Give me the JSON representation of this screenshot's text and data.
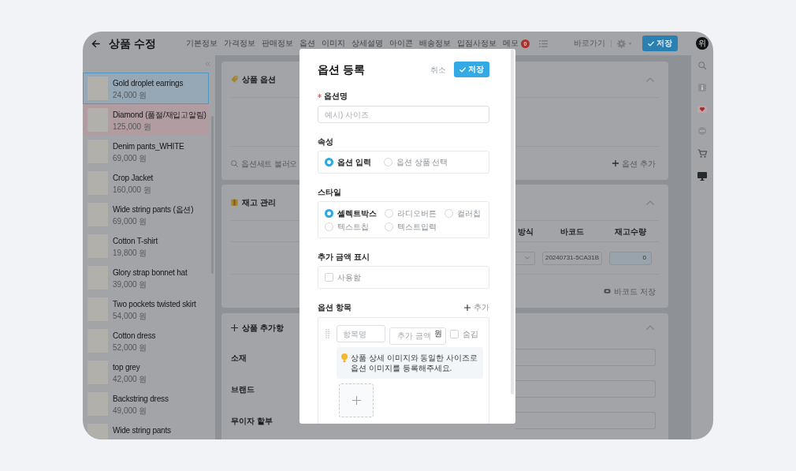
{
  "topbar": {
    "title": "상품 수정",
    "tabs": [
      {
        "label": "기본정보"
      },
      {
        "label": "가격정보"
      },
      {
        "label": "판매정보"
      },
      {
        "label": "옵션"
      },
      {
        "label": "이미지"
      },
      {
        "label": "상세설명"
      },
      {
        "label": "아이콘"
      },
      {
        "label": "배송정보"
      },
      {
        "label": "입점사정보"
      },
      {
        "label": "메모",
        "badge": "0"
      }
    ],
    "shortcut": "바로가기",
    "save": "저장"
  },
  "user": {
    "initial": "위"
  },
  "sidebar": {
    "items": [
      {
        "name": "Gold droplet earrings",
        "price": "24,000 원",
        "selected": true,
        "highlighted": false
      },
      {
        "name": "Diamond (품절/재입고알림)",
        "price": "125,000 원",
        "selected": false,
        "highlighted": true
      },
      {
        "name": "Denim pants_WHITE",
        "price": "69,000 원",
        "selected": false,
        "highlighted": false
      },
      {
        "name": "Crop Jacket",
        "price": "160,000 원",
        "selected": false,
        "highlighted": false
      },
      {
        "name": "Wide string pants (옵션)",
        "price": "69,000 원",
        "selected": false,
        "highlighted": false
      },
      {
        "name": "Cotton T-shirt",
        "price": "19,800 원",
        "selected": false,
        "highlighted": false
      },
      {
        "name": "Glory strap bonnet hat",
        "price": "39,000 원",
        "selected": false,
        "highlighted": false
      },
      {
        "name": "Two pockets twisted skirt",
        "price": "54,000 원",
        "selected": false,
        "highlighted": false
      },
      {
        "name": "Cotton dress",
        "price": "52,000 원",
        "selected": false,
        "highlighted": false
      },
      {
        "name": "top grey",
        "price": "42,000 원",
        "selected": false,
        "highlighted": false
      },
      {
        "name": "Backstring dress",
        "price": "49,000 원",
        "selected": false,
        "highlighted": false
      },
      {
        "name": "Wide string pants",
        "selected": false,
        "highlighted": false
      }
    ]
  },
  "option_card": {
    "title": "상품 옵션",
    "expanded": true,
    "load_set": "옵션세트 불러오",
    "add_option": "옵션 추가"
  },
  "stock_card": {
    "title": "재고 관리",
    "expanded": true,
    "columns": [
      "방식",
      "바코드",
      "재고수량"
    ],
    "rows": [
      {
        "barcode": "20240731-5CA31B",
        "quantity": "0"
      }
    ],
    "save_barcode": "바코드 저장"
  },
  "extra_card": {
    "title": "상품 추가항",
    "expanded": true,
    "fields": [
      {
        "label": "소재"
      },
      {
        "label": "브랜드"
      },
      {
        "label": "무이자 할부"
      }
    ]
  },
  "modal": {
    "title": "옵션 등록",
    "cancel": "취소",
    "save": "저장",
    "name_field": {
      "label": "옵션명",
      "required": true,
      "placeholder": "예시) 사이즈"
    },
    "attribute": {
      "label": "속성",
      "options": [
        {
          "label": "옵션 입력",
          "selected": true
        },
        {
          "label": "옵션 상품 선택",
          "selected": false
        }
      ]
    },
    "style": {
      "label": "스타일",
      "options": [
        {
          "label": "셀렉트박스",
          "selected": true
        },
        {
          "label": "라디오버튼",
          "selected": false
        },
        {
          "label": "컬러칩",
          "selected": false
        },
        {
          "label": "텍스트칩",
          "selected": false
        },
        {
          "label": "텍스트입력",
          "selected": false
        }
      ]
    },
    "extra_price": {
      "label": "추가 금액 표시",
      "option": {
        "label": "사용함",
        "checked": false
      }
    },
    "items": {
      "label": "옵션 항목",
      "add": "추가",
      "rows": [
        {
          "name_placeholder": "항목명",
          "price_placeholder": "추가 금액",
          "currency": "원",
          "hide": {
            "label": "숨김",
            "checked": false
          },
          "tip": "상품 상세 이미지와 동일한 사이즈로 옵션 이미지를 등록해주세요."
        }
      ]
    }
  }
}
